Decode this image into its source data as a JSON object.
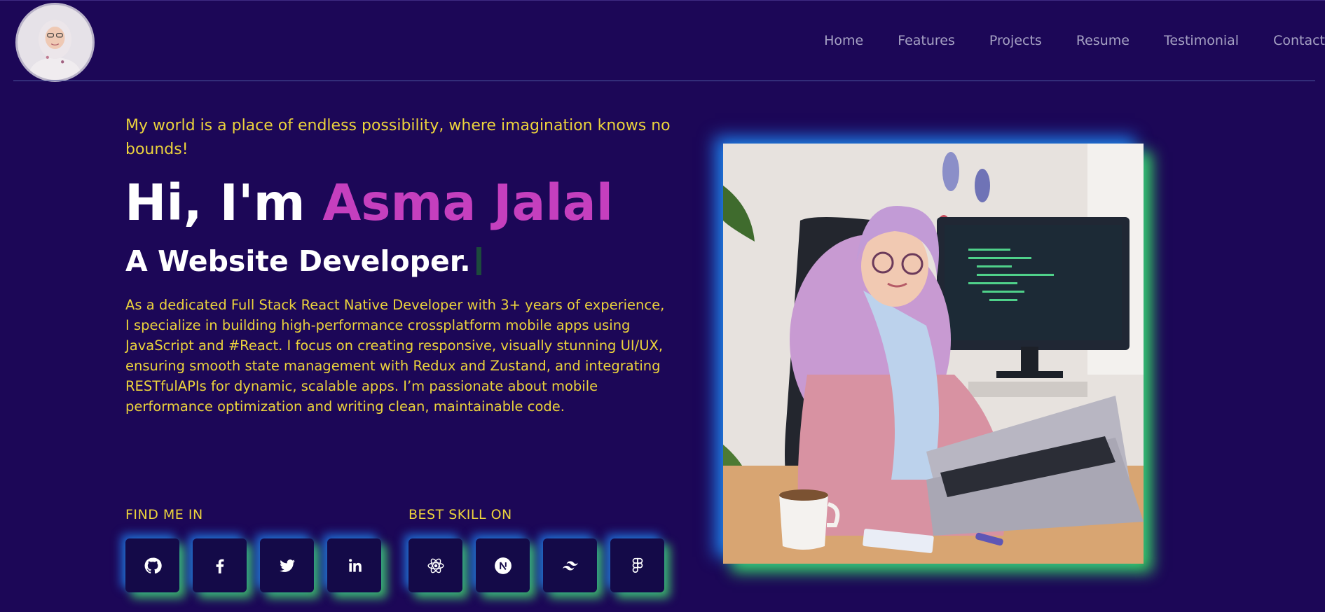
{
  "header": {
    "avatar_alt": "Asma Jalal avatar",
    "nav": [
      {
        "label": "Home"
      },
      {
        "label": "Features"
      },
      {
        "label": "Projects"
      },
      {
        "label": "Resume"
      },
      {
        "label": "Testimonial"
      },
      {
        "label": "Contact"
      }
    ]
  },
  "hero": {
    "tagline": "My world is a place of endless possibility, where imagination knows no bounds!",
    "greeting_prefix": "Hi, I'm",
    "name": "Asma Jalal",
    "role": "A Website Developer.",
    "bio": "As a dedicated Full Stack React Native Developer with 3+ years of experience, I specialize in building high-performance crossplatform mobile apps using JavaScript and #React. I focus on creating responsive, visually stunning UI/UX, ensuring smooth state management with Redux and Zustand, and integrating RESTfulAPIs for dynamic, scalable apps. I’m passionate about mobile performance optimization and writing clean, maintainable code.",
    "find_me_label": "FIND ME IN",
    "skills_label": "BEST SKILL ON",
    "social_icons": [
      "github-icon",
      "facebook-icon",
      "twitter-icon",
      "linkedin-icon"
    ],
    "skill_icons": [
      "react-icon",
      "nextjs-icon",
      "tailwind-icon",
      "figma-icon"
    ]
  },
  "colors": {
    "background": "#1c0757",
    "accent_yellow": "#ecd33c",
    "accent_magenta": "#c53fbe",
    "glow_blue": "#228cff",
    "glow_green": "#46e66e"
  }
}
